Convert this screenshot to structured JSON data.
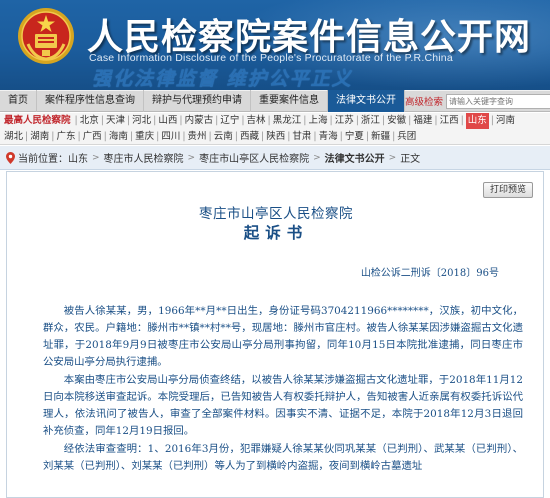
{
  "header": {
    "title": "人民检察院案件信息公开网",
    "subtitle": "Case Information Disclosure of the People's Procuratorate of the P.R.China",
    "slogan": "强化法律监督 维护公平正义"
  },
  "nav": {
    "items": [
      {
        "label": "首页"
      },
      {
        "label": "案件程序性信息查询"
      },
      {
        "label": "辩护与代理预约申请"
      },
      {
        "label": "重要案件信息"
      },
      {
        "label": "法律文书公开",
        "active": true
      }
    ],
    "search_label": "高级检索",
    "search_placeholder": "请输入关键字查询"
  },
  "provinces": {
    "lead": "最高人民检察院",
    "row1": [
      "北京",
      "天津",
      "河北",
      "山西",
      "内蒙古",
      "辽宁",
      "吉林",
      "黑龙江",
      "上海",
      "江苏",
      "浙江",
      "安徽",
      "福建",
      "江西",
      "山东",
      "河南"
    ],
    "row2": [
      "湖北",
      "湖南",
      "广东",
      "广西",
      "海南",
      "重庆",
      "四川",
      "贵州",
      "云南",
      "西藏",
      "陕西",
      "甘肃",
      "青海",
      "宁夏",
      "新疆",
      "兵团"
    ],
    "current": "山东"
  },
  "breadcrumb": {
    "prefix": "当前位置：",
    "items": [
      "山东",
      "枣庄市人民检察院",
      "枣庄市山亭区人民检察院",
      "法律文书公开",
      "正文"
    ]
  },
  "document": {
    "print_label": "打印预览",
    "org": "枣庄市山亭区人民检察院",
    "title": "起诉书",
    "number": "山检公诉二刑诉〔2018〕96号",
    "paragraphs": [
      "被告人徐某某，男，1966年**月**日出生，身份证号码3704211966********，汉族，初中文化，群众，农民。户籍地：滕州市**镇**村**号，现居地：滕州市官庄村。被告人徐某某因涉嫌盗掘古文化遗址罪，于2018年9月9日被枣庄市公安局山亭分局刑事拘留，同年10月15日本院批准逮捕，同日枣庄市公安局山亭分局执行逮捕。",
      "本案由枣庄市公安局山亭分局侦查终结，以被告人徐某某涉嫌盗掘古文化遗址罪，于2018年11月12日向本院移送审查起诉。本院受理后，已告知被告人有权委托辩护人，告知被害人近亲属有权委托诉讼代理人，依法讯问了被告人，审查了全部案件材料。因事实不清、证据不足，本院于2018年12月3日退回补充侦查，同年12月19日报回。",
      "经依法审查查明：1、2016年3月份，犯罪嫌疑人徐某某伙同巩某某（已判刑）、武某某（已判刑）、刘某某（已判刑）、刘某某（已判刑）等人为了到横岭内盗掘，夜间到横岭古墓遗址"
    ]
  }
}
